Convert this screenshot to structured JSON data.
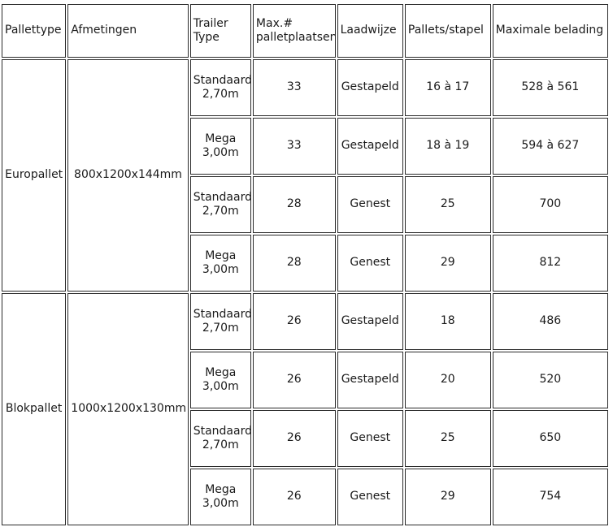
{
  "table": {
    "headers": {
      "pallet_type": "Pallettype",
      "dimensions": "Afmetingen",
      "trailer_type_line1": "Trailer",
      "trailer_type_line2": "Type",
      "max_pallet_places_line1": "Max.",
      "max_pallet_places_hash": "#",
      "max_pallet_places_line2": "palletplaatsen",
      "loading_method": "Laadwijze",
      "pallets_per_stack": "Pallets/stapel",
      "max_load": "Maximale belading"
    },
    "groups": [
      {
        "pallet_type": "Europallet",
        "dimensions": "800x1200x144mm",
        "rows": [
          {
            "trailer_name": "Standaard",
            "trailer_height": "2,70m",
            "max_pallet_places": "33",
            "loading_method": "Gestapeld",
            "pallets_per_stack": "16 à 17",
            "max_load": "528 à 561"
          },
          {
            "trailer_name": "Mega",
            "trailer_height": "3,00m",
            "max_pallet_places": "33",
            "loading_method": "Gestapeld",
            "pallets_per_stack": "18 à 19",
            "max_load": "594 à 627"
          },
          {
            "trailer_name": "Standaard",
            "trailer_height": "2,70m",
            "max_pallet_places": "28",
            "loading_method": "Genest",
            "pallets_per_stack": "25",
            "max_load": "700"
          },
          {
            "trailer_name": "Mega",
            "trailer_height": "3,00m",
            "max_pallet_places": "28",
            "loading_method": "Genest",
            "pallets_per_stack": "29",
            "max_load": "812"
          }
        ]
      },
      {
        "pallet_type": "Blokpallet",
        "dimensions": "1000x1200x130mm",
        "rows": [
          {
            "trailer_name": "Standaard",
            "trailer_height": "2,70m",
            "max_pallet_places": "26",
            "loading_method": "Gestapeld",
            "pallets_per_stack": "18",
            "max_load": "486"
          },
          {
            "trailer_name": "Mega",
            "trailer_height": "3,00m",
            "max_pallet_places": "26",
            "loading_method": "Gestapeld",
            "pallets_per_stack": "20",
            "max_load": "520"
          },
          {
            "trailer_name": "Standaard",
            "trailer_height": "2,70m",
            "max_pallet_places": "26",
            "loading_method": "Genest",
            "pallets_per_stack": "25",
            "max_load": "650"
          },
          {
            "trailer_name": "Mega",
            "trailer_height": "3,00m",
            "max_pallet_places": "26",
            "loading_method": "Genest",
            "pallets_per_stack": "29",
            "max_load": "754"
          }
        ]
      }
    ]
  },
  "colors": {
    "border": "#2b2b2b",
    "text": "#1a1a1a",
    "background": "#ffffff"
  }
}
